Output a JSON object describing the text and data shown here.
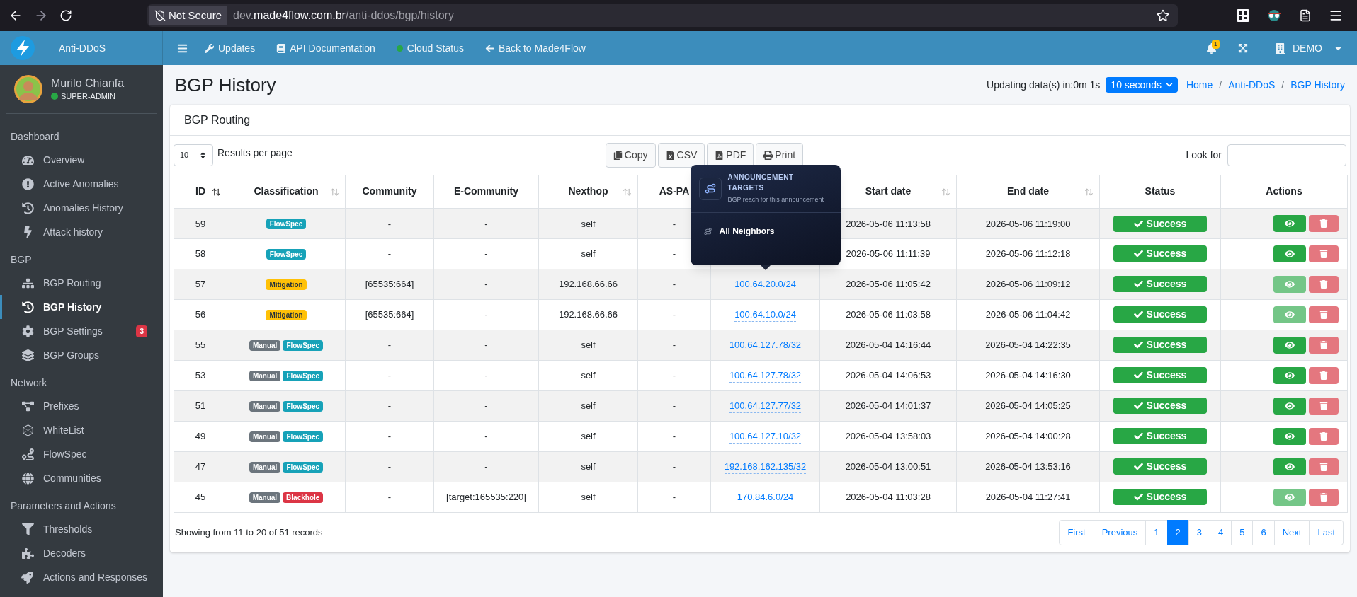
{
  "browser": {
    "security": "Not Secure",
    "url_prefix": "dev.",
    "url_host": "made4flow.com.br",
    "url_path": "/anti-ddos/bgp/history"
  },
  "brand": {
    "name": "Anti-DDoS"
  },
  "topnav": [
    {
      "label": "Updates"
    },
    {
      "label": "API Documentation"
    },
    {
      "label": "Cloud Status",
      "color": "#28a745"
    },
    {
      "label": "Back to Made4Flow"
    }
  ],
  "notifications": {
    "count": "1"
  },
  "tenant": {
    "label": "DEMO"
  },
  "user": {
    "name": "Murilo Chianfa",
    "role": "SUPER-ADMIN",
    "online": true
  },
  "sidebar": [
    {
      "header": "Dashboard",
      "items": [
        {
          "label": "Overview",
          "selected": false
        },
        {
          "label": "Active Anomalies",
          "selected": false
        },
        {
          "label": "Anomalies History",
          "selected": false
        },
        {
          "label": "Attack history",
          "selected": false
        }
      ]
    },
    {
      "header": "BGP",
      "items": [
        {
          "label": "BGP Routing",
          "selected": false
        },
        {
          "label": "BGP History",
          "selected": true
        },
        {
          "label": "BGP Settings",
          "selected": false,
          "badge": "3"
        },
        {
          "label": "BGP Groups",
          "selected": false
        }
      ]
    },
    {
      "header": "Network",
      "items": [
        {
          "label": "Prefixes",
          "selected": false
        },
        {
          "label": "WhiteList",
          "selected": false
        },
        {
          "label": "FlowSpec",
          "selected": false
        },
        {
          "label": "Communities",
          "selected": false
        }
      ]
    },
    {
      "header": "Parameters and Actions",
      "items": [
        {
          "label": "Thresholds",
          "selected": false
        },
        {
          "label": "Decoders",
          "selected": false
        },
        {
          "label": "Actions and Responses",
          "selected": false
        }
      ]
    }
  ],
  "page": {
    "title": "BGP History",
    "updating": "Updating data(s) in:0m 1s",
    "interval": "10 seconds",
    "breadcrumb_separator": "/",
    "breadcrumbs": [
      {
        "label": "Home"
      },
      {
        "label": "Anti-DDoS"
      },
      {
        "label": "BGP History"
      }
    ]
  },
  "card": {
    "title": "BGP Routing",
    "page_size": "10",
    "page_size_label": "Results per page",
    "exports": [
      {
        "label": "Copy"
      },
      {
        "label": "CSV"
      },
      {
        "label": "PDF"
      },
      {
        "label": "Print"
      }
    ],
    "search_label": "Look for"
  },
  "table": {
    "columns": [
      {
        "label": "ID",
        "sortable": true,
        "sorted": true
      },
      {
        "label": "Classification",
        "sortable": true,
        "sorted": false
      },
      {
        "label": "Community",
        "sortable": false
      },
      {
        "label": "E-Community",
        "sortable": false
      },
      {
        "label": "Nexthop",
        "sortable": true,
        "sorted": false
      },
      {
        "label": "AS-PA",
        "sortable": false
      },
      {
        "label": "Start date",
        "sortable": true,
        "sorted": false
      },
      {
        "label": "End date",
        "sortable": true,
        "sorted": false
      },
      {
        "label": "Status",
        "sortable": false
      },
      {
        "label": "Actions",
        "sortable": false
      }
    ],
    "rows": [
      {
        "id": "59",
        "tags": [
          {
            "label": "FlowSpec",
            "kind": "flowspec"
          }
        ],
        "community": "-",
        "e_community": "-",
        "nexthop": "self",
        "as_path": "-",
        "start": "2026-05-06 11:13:58",
        "end": "2026-05-06 11:19:00",
        "status": "Success",
        "view_disabled": false
      },
      {
        "id": "58",
        "tags": [
          {
            "label": "FlowSpec",
            "kind": "flowspec"
          }
        ],
        "community": "-",
        "e_community": "-",
        "nexthop": "self",
        "as_path": "-",
        "start": "2026-05-06 11:11:39",
        "end": "2026-05-06 11:12:18",
        "status": "Success",
        "view_disabled": false
      },
      {
        "id": "57",
        "tags": [
          {
            "label": "Mitigation",
            "kind": "mitigation"
          }
        ],
        "community": "[65535:664]",
        "e_community": "-",
        "nexthop": "192.168.66.66",
        "as_path": "-",
        "prefix": "100.64.20.0/24",
        "start": "2026-05-06 11:05:42",
        "end": "2026-05-06 11:09:12",
        "status": "Success",
        "view_disabled": true,
        "tooltip": {
          "title": "ANNOUNCEMENT TARGETS",
          "subtitle": "BGP reach for this announcement",
          "item": "All Neighbors"
        }
      },
      {
        "id": "56",
        "tags": [
          {
            "label": "Mitigation",
            "kind": "mitigation"
          }
        ],
        "community": "[65535:664]",
        "e_community": "-",
        "nexthop": "192.168.66.66",
        "as_path": "-",
        "prefix": "100.64.10.0/24",
        "start": "2026-05-06 11:03:58",
        "end": "2026-05-06 11:04:42",
        "status": "Success",
        "view_disabled": true
      },
      {
        "id": "55",
        "tags": [
          {
            "label": "Manual",
            "kind": "manual"
          },
          {
            "label": "FlowSpec",
            "kind": "flowspec"
          }
        ],
        "community": "-",
        "e_community": "-",
        "nexthop": "self",
        "as_path": "-",
        "prefix": "100.64.127.78/32",
        "start": "2026-05-04 14:16:44",
        "end": "2026-05-04 14:22:35",
        "status": "Success",
        "view_disabled": false
      },
      {
        "id": "53",
        "tags": [
          {
            "label": "Manual",
            "kind": "manual"
          },
          {
            "label": "FlowSpec",
            "kind": "flowspec"
          }
        ],
        "community": "-",
        "e_community": "-",
        "nexthop": "self",
        "as_path": "-",
        "prefix": "100.64.127.78/32",
        "start": "2026-05-04 14:06:53",
        "end": "2026-05-04 14:16:30",
        "status": "Success",
        "view_disabled": false
      },
      {
        "id": "51",
        "tags": [
          {
            "label": "Manual",
            "kind": "manual"
          },
          {
            "label": "FlowSpec",
            "kind": "flowspec"
          }
        ],
        "community": "-",
        "e_community": "-",
        "nexthop": "self",
        "as_path": "-",
        "prefix": "100.64.127.77/32",
        "start": "2026-05-04 14:01:37",
        "end": "2026-05-04 14:05:25",
        "status": "Success",
        "view_disabled": false
      },
      {
        "id": "49",
        "tags": [
          {
            "label": "Manual",
            "kind": "manual"
          },
          {
            "label": "FlowSpec",
            "kind": "flowspec"
          }
        ],
        "community": "-",
        "e_community": "-",
        "nexthop": "self",
        "as_path": "-",
        "prefix": "100.64.127.10/32",
        "start": "2026-05-04 13:58:03",
        "end": "2026-05-04 14:00:28",
        "status": "Success",
        "view_disabled": false
      },
      {
        "id": "47",
        "tags": [
          {
            "label": "Manual",
            "kind": "manual"
          },
          {
            "label": "FlowSpec",
            "kind": "flowspec"
          }
        ],
        "community": "-",
        "e_community": "-",
        "nexthop": "self",
        "as_path": "-",
        "prefix": "192.168.162.135/32",
        "start": "2026-05-04 13:00:51",
        "end": "2026-05-04 13:53:16",
        "status": "Success",
        "view_disabled": false
      },
      {
        "id": "45",
        "tags": [
          {
            "label": "Manual",
            "kind": "manual"
          },
          {
            "label": "Blackhole",
            "kind": "blackhole"
          }
        ],
        "community": "-",
        "e_community": "[target:165535:220]",
        "nexthop": "self",
        "as_path": "-",
        "prefix": "170.84.6.0/24",
        "start": "2026-05-04 11:03:28",
        "end": "2026-05-04 11:27:41",
        "status": "Success",
        "view_disabled": true
      }
    ]
  },
  "footer": {
    "info": "Showing from 11 to 20 of 51 records"
  },
  "pagination": [
    {
      "label": "First",
      "selected": false
    },
    {
      "label": "Previous",
      "selected": false
    },
    {
      "label": "1",
      "selected": false
    },
    {
      "label": "2",
      "selected": true
    },
    {
      "label": "3",
      "selected": false
    },
    {
      "label": "4",
      "selected": false
    },
    {
      "label": "5",
      "selected": false
    },
    {
      "label": "6",
      "selected": false
    },
    {
      "label": "Next",
      "selected": false
    },
    {
      "label": "Last",
      "selected": false
    }
  ]
}
